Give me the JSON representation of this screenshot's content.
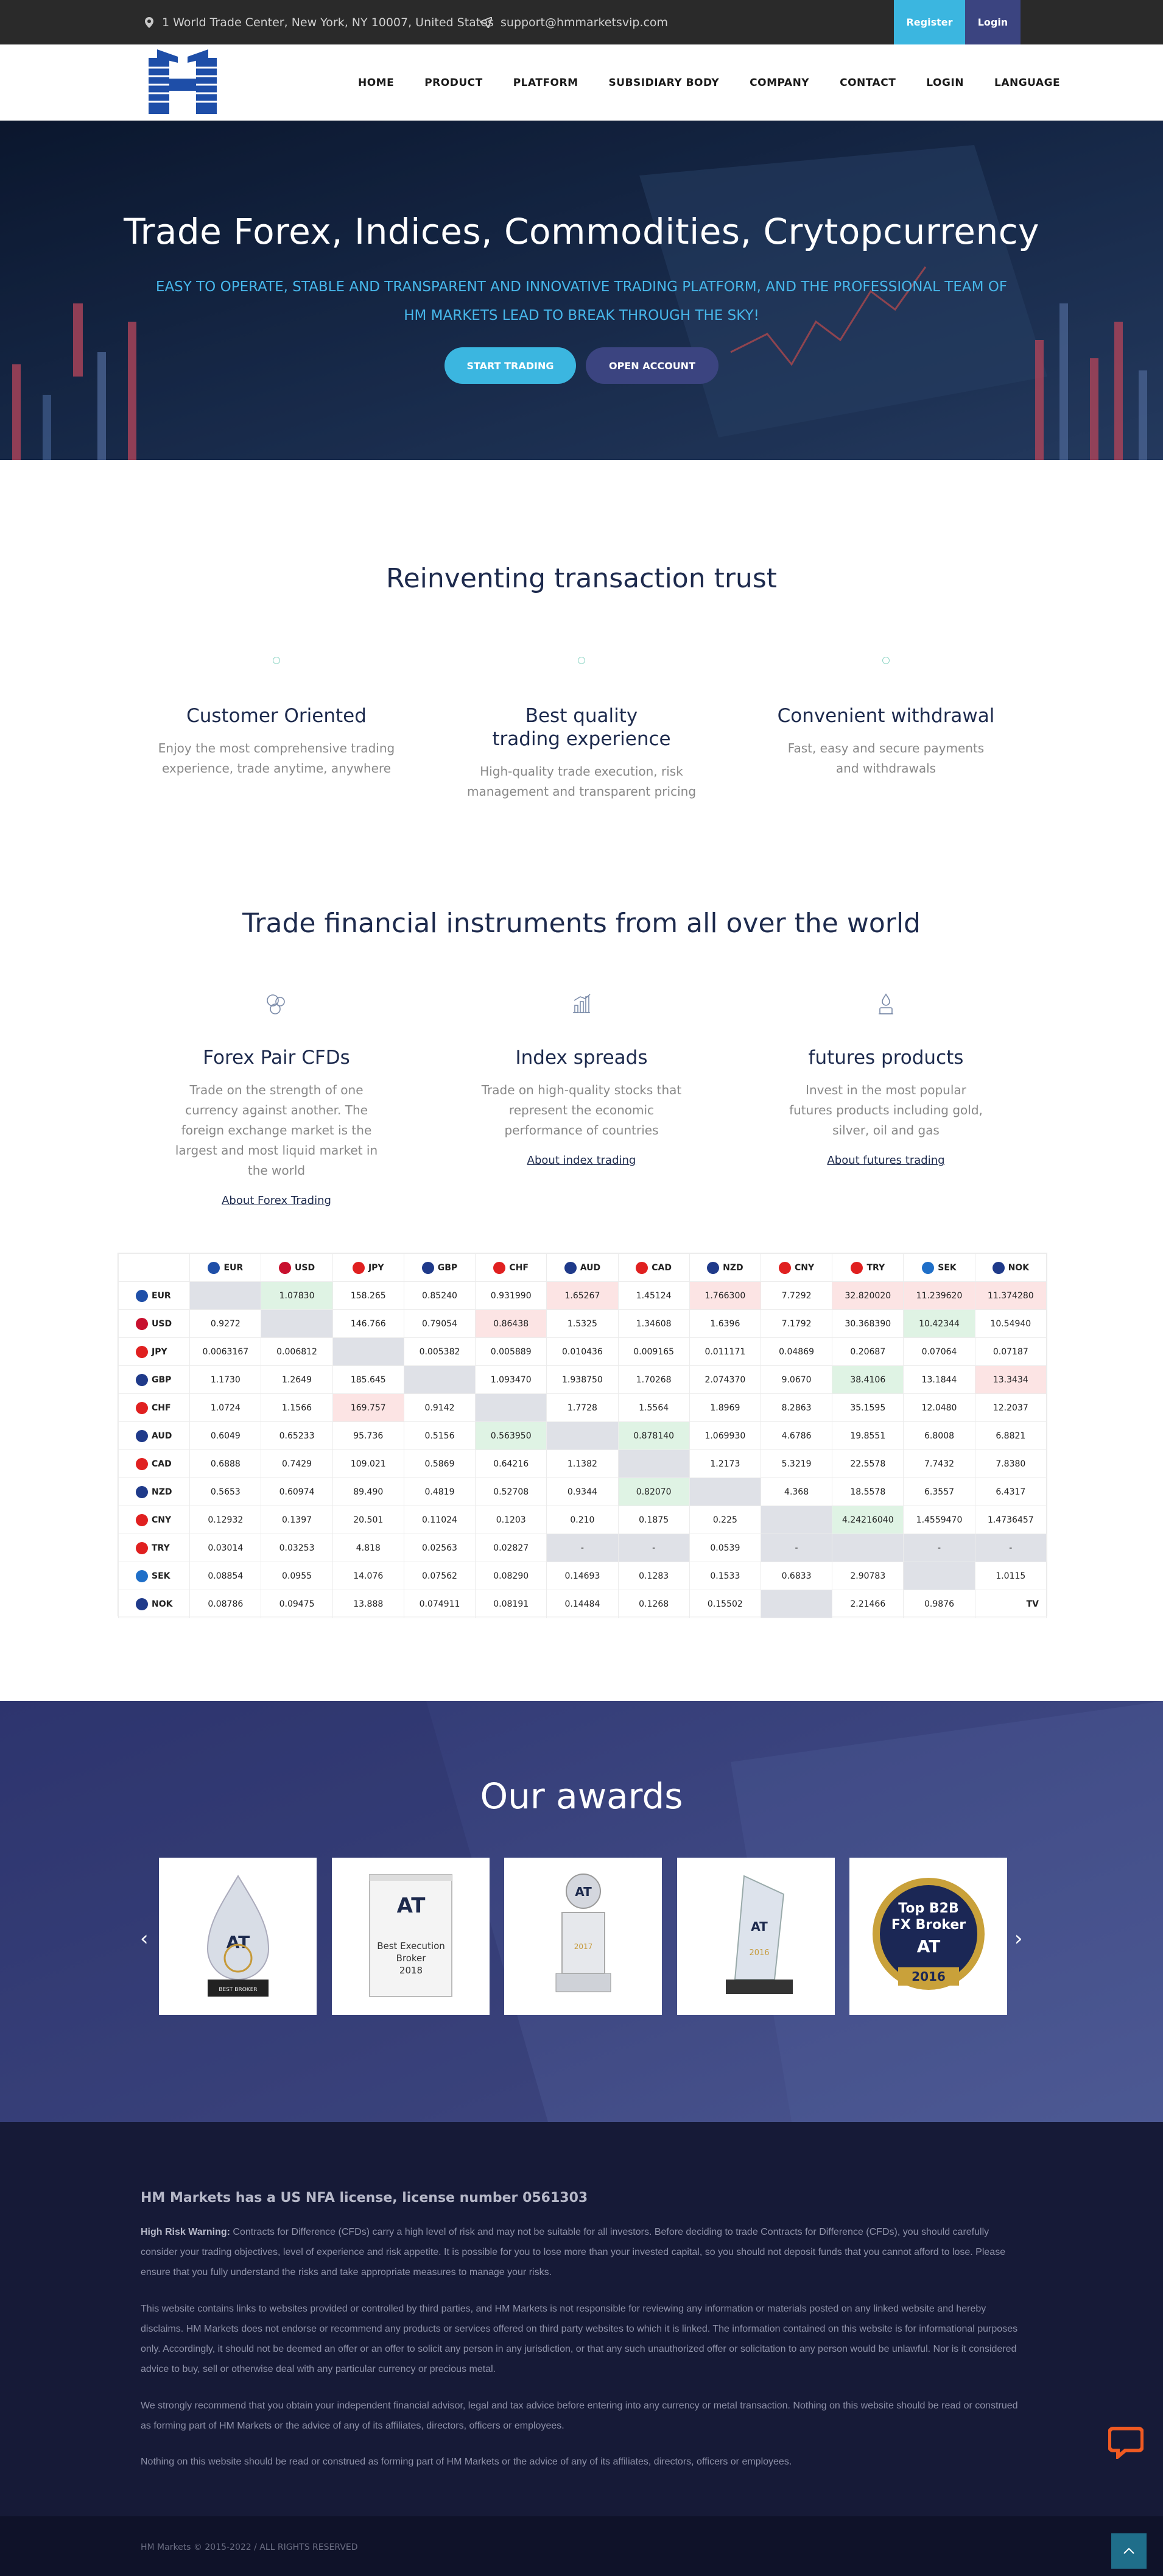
{
  "topbar": {
    "address": "1 World Trade Center, New York, NY 10007, United States",
    "email": "support@hmmarketsvip.com",
    "register_label": "Register",
    "login_label": "Login",
    "colors": {
      "register_bg": "#3bb6e0",
      "login_bg": "#3b4480"
    }
  },
  "nav": {
    "items": [
      "HOME",
      "PRODUCT",
      "PLATFORM",
      "SUBSIDIARY BODY",
      "COMPANY",
      "CONTACT",
      "LOGIN",
      "LANGUAGE"
    ]
  },
  "hero": {
    "title": "Trade Forex, Indices, Commodities, Crytopcurrency",
    "subtitle": "EASY TO OPERATE, STABLE AND TRANSPARENT AND INNOVATIVE TRADING PLATFORM, AND THE PROFESSIONAL TEAM OF HM MARKETS LEAD TO BREAK THROUGH THE SKY!",
    "start_trading_label": "START TRADING",
    "open_account_label": "OPEN ACCOUNT"
  },
  "trust": {
    "title": "Reinventing transaction trust",
    "features": [
      {
        "title": "Customer Oriented",
        "text": "Enjoy the most comprehensive trading experience, trade anytime, anywhere"
      },
      {
        "title": "Best quality trading experience",
        "text": "High-quality trade execution, risk management and transparent pricing"
      },
      {
        "title": "Convenient withdrawal",
        "text": "Fast, easy and secure payments and withdrawals"
      }
    ]
  },
  "instruments": {
    "title": "Trade financial instruments from all over the world",
    "items": [
      {
        "icon": "coins-icon",
        "title": "Forex Pair CFDs",
        "text": "Trade on the strength of one currency against another. The foreign exchange market is the largest and most liquid market in the world",
        "link": "About Forex Trading"
      },
      {
        "icon": "bar-chart-icon",
        "title": "Index spreads",
        "text": "Trade on high-quality stocks that represent the economic performance of countries",
        "link": "About index trading"
      },
      {
        "icon": "oil-drum-icon",
        "title": "futures products",
        "text": "Invest in the most popular futures products including gold, silver, oil and gas",
        "link": "About futures trading"
      }
    ]
  },
  "cross_table": {
    "currencies": [
      "EUR",
      "USD",
      "JPY",
      "GBP",
      "CHF",
      "AUD",
      "CAD",
      "NZD",
      "CNY",
      "TRY",
      "SEK",
      "NOK"
    ],
    "flag_colors": [
      "#1f4fa8",
      "#c8102e",
      "#e02020",
      "#1f3a8a",
      "#e02020",
      "#1f3a8a",
      "#e02020",
      "#1f3a8a",
      "#e02020",
      "#e02020",
      "#1f6fc8",
      "#1f3a8a"
    ],
    "rows": [
      [
        "",
        "1.07830",
        "158.265",
        "0.85240",
        "0.931990",
        "1.65267",
        "1.45124",
        "1.766300",
        "7.7292",
        "32.820020",
        "11.239620",
        "11.374280"
      ],
      [
        "0.9272",
        "",
        "146.766",
        "0.79054",
        "0.86438",
        "1.5325",
        "1.34608",
        "1.6396",
        "7.1792",
        "30.368390",
        "10.42344",
        "10.54940"
      ],
      [
        "0.0063167",
        "0.006812",
        "",
        "0.005382",
        "0.005889",
        "0.010436",
        "0.009165",
        "0.011171",
        "0.04869",
        "0.20687",
        "0.07064",
        "0.07187"
      ],
      [
        "1.1730",
        "1.2649",
        "185.645",
        "",
        "1.093470",
        "1.938750",
        "1.70268",
        "2.074370",
        "9.0670",
        "38.4106",
        "13.1844",
        "13.3434"
      ],
      [
        "1.0724",
        "1.1566",
        "169.757",
        "0.9142",
        "",
        "1.7728",
        "1.5564",
        "1.8969",
        "8.2863",
        "35.1595",
        "12.0480",
        "12.2037"
      ],
      [
        "0.6049",
        "0.65233",
        "95.736",
        "0.5156",
        "0.563950",
        "",
        "0.878140",
        "1.069930",
        "4.6786",
        "19.8551",
        "6.8008",
        "6.8821"
      ],
      [
        "0.6888",
        "0.7429",
        "109.021",
        "0.5869",
        "0.64216",
        "1.1382",
        "",
        "1.2173",
        "5.3219",
        "22.5578",
        "7.7432",
        "7.8380"
      ],
      [
        "0.5653",
        "0.60974",
        "89.490",
        "0.4819",
        "0.52708",
        "0.9344",
        "0.82070",
        "",
        "4.368",
        "18.5578",
        "6.3557",
        "6.4317"
      ],
      [
        "0.12932",
        "0.1397",
        "20.501",
        "0.11024",
        "0.1203",
        "0.210",
        "0.1875",
        "0.225",
        "",
        "4.24216040",
        "1.4559470",
        "1.4736457"
      ],
      [
        "0.03014",
        "0.03253",
        "4.818",
        "0.02563",
        "0.02827",
        "-",
        "-",
        "0.0539",
        "-",
        "",
        "-",
        "-"
      ],
      [
        "0.08854",
        "0.0955",
        "14.076",
        "0.07562",
        "0.08290",
        "0.14693",
        "0.1283",
        "0.1533",
        "0.6833",
        "2.90783",
        "",
        "1.0115"
      ],
      [
        "0.08786",
        "0.09475",
        "13.888",
        "0.074911",
        "0.08191",
        "0.14484",
        "0.1268",
        "0.15502",
        "",
        "2.21466",
        "0.9876",
        ""
      ]
    ],
    "cell_states": [
      [
        "d",
        "g",
        "",
        "",
        "",
        "r",
        "",
        "r",
        "",
        "r",
        "r",
        "r"
      ],
      [
        "",
        "d",
        "",
        "",
        "r",
        "",
        "",
        "",
        "",
        "",
        "g",
        ""
      ],
      [
        "",
        "",
        "d",
        "",
        "",
        "",
        "",
        "",
        "",
        "",
        "",
        ""
      ],
      [
        "",
        "",
        "",
        "d",
        "",
        "",
        "",
        "",
        "",
        "g",
        "",
        "r"
      ],
      [
        "",
        "",
        "r",
        "",
        "d",
        "",
        "",
        "",
        "",
        "",
        "",
        ""
      ],
      [
        "",
        "",
        "",
        "",
        "g",
        "d",
        "g",
        "",
        "",
        "",
        "",
        ""
      ],
      [
        "",
        "",
        "",
        "",
        "",
        "",
        "d",
        "",
        "",
        "",
        "",
        ""
      ],
      [
        "",
        "",
        "",
        "",
        "",
        "",
        "g",
        "d",
        "",
        "",
        "",
        ""
      ],
      [
        "",
        "",
        "",
        "",
        "",
        "",
        "",
        "",
        "d",
        "g",
        "",
        ""
      ],
      [
        "",
        "",
        "",
        "",
        "",
        "d",
        "d",
        "",
        "d",
        "d",
        "d",
        "d"
      ],
      [
        "",
        "",
        "",
        "",
        "",
        "",
        "",
        "",
        "",
        "",
        "d",
        ""
      ],
      [
        "",
        "",
        "",
        "",
        "",
        "",
        "",
        "",
        "d",
        "",
        "",
        ""
      ]
    ],
    "watermark": "TV"
  },
  "awards": {
    "title": "Our awards",
    "items": [
      {
        "icon": "crystal-drop-trophy-icon",
        "caption": "BEST BROKER"
      },
      {
        "icon": "certificate-plaque-icon",
        "caption": "Best Execution Broker 2018"
      },
      {
        "icon": "trophy-icon",
        "caption": "2017"
      },
      {
        "icon": "glass-award-icon",
        "caption": "2016"
      },
      {
        "icon": "gold-medal-icon",
        "caption": "Top B2B FX Broker 2016"
      }
    ],
    "brand_text": "AT"
  },
  "footer": {
    "license": "HM Markets has a US NFA license, license number 0561303",
    "warning_label": "High Risk Warning:",
    "warning_text": " Contracts for Difference (CFDs) carry a high level of risk and may not be suitable for all investors. Before deciding to trade Contracts for Difference (CFDs), you should carefully consider your trading objectives, level of experience and risk appetite. It is possible for you to lose more than your invested capital, so you should not deposit funds that you cannot afford to lose. Please ensure that you fully understand the risks and take appropriate measures to manage your risks.",
    "links_text": "This website contains links to websites provided or controlled by third parties, and HM Markets is not responsible for reviewing any information or materials posted on any linked website and hereby disclaims. HM Markets does not endorse or recommend any products or services offered on third party websites to which it is linked. The information contained on this website is for informational purposes only. Accordingly, it should not be deemed an offer or an offer to solicit any person in any jurisdiction, or that any such unauthorized offer or solicitation to any person would be unlawful. Nor is it considered advice to buy, sell or otherwise deal with any particular currency or precious metal.",
    "advice_text": "We strongly recommend that you obtain your independent financial advisor, legal and tax advice before entering into any currency or metal transaction. Nothing on this website should be read or construed as forming part of HM Markets or the advice of any of its affiliates, directors, officers or employees.",
    "nothing_text": "Nothing on this website should be read or construed as forming part of HM Markets or the advice of any of its affiliates, directors, officers or employees.",
    "copyright": "HM Markets © 2015-2022 / ALL RIGHTS RESERVED"
  }
}
